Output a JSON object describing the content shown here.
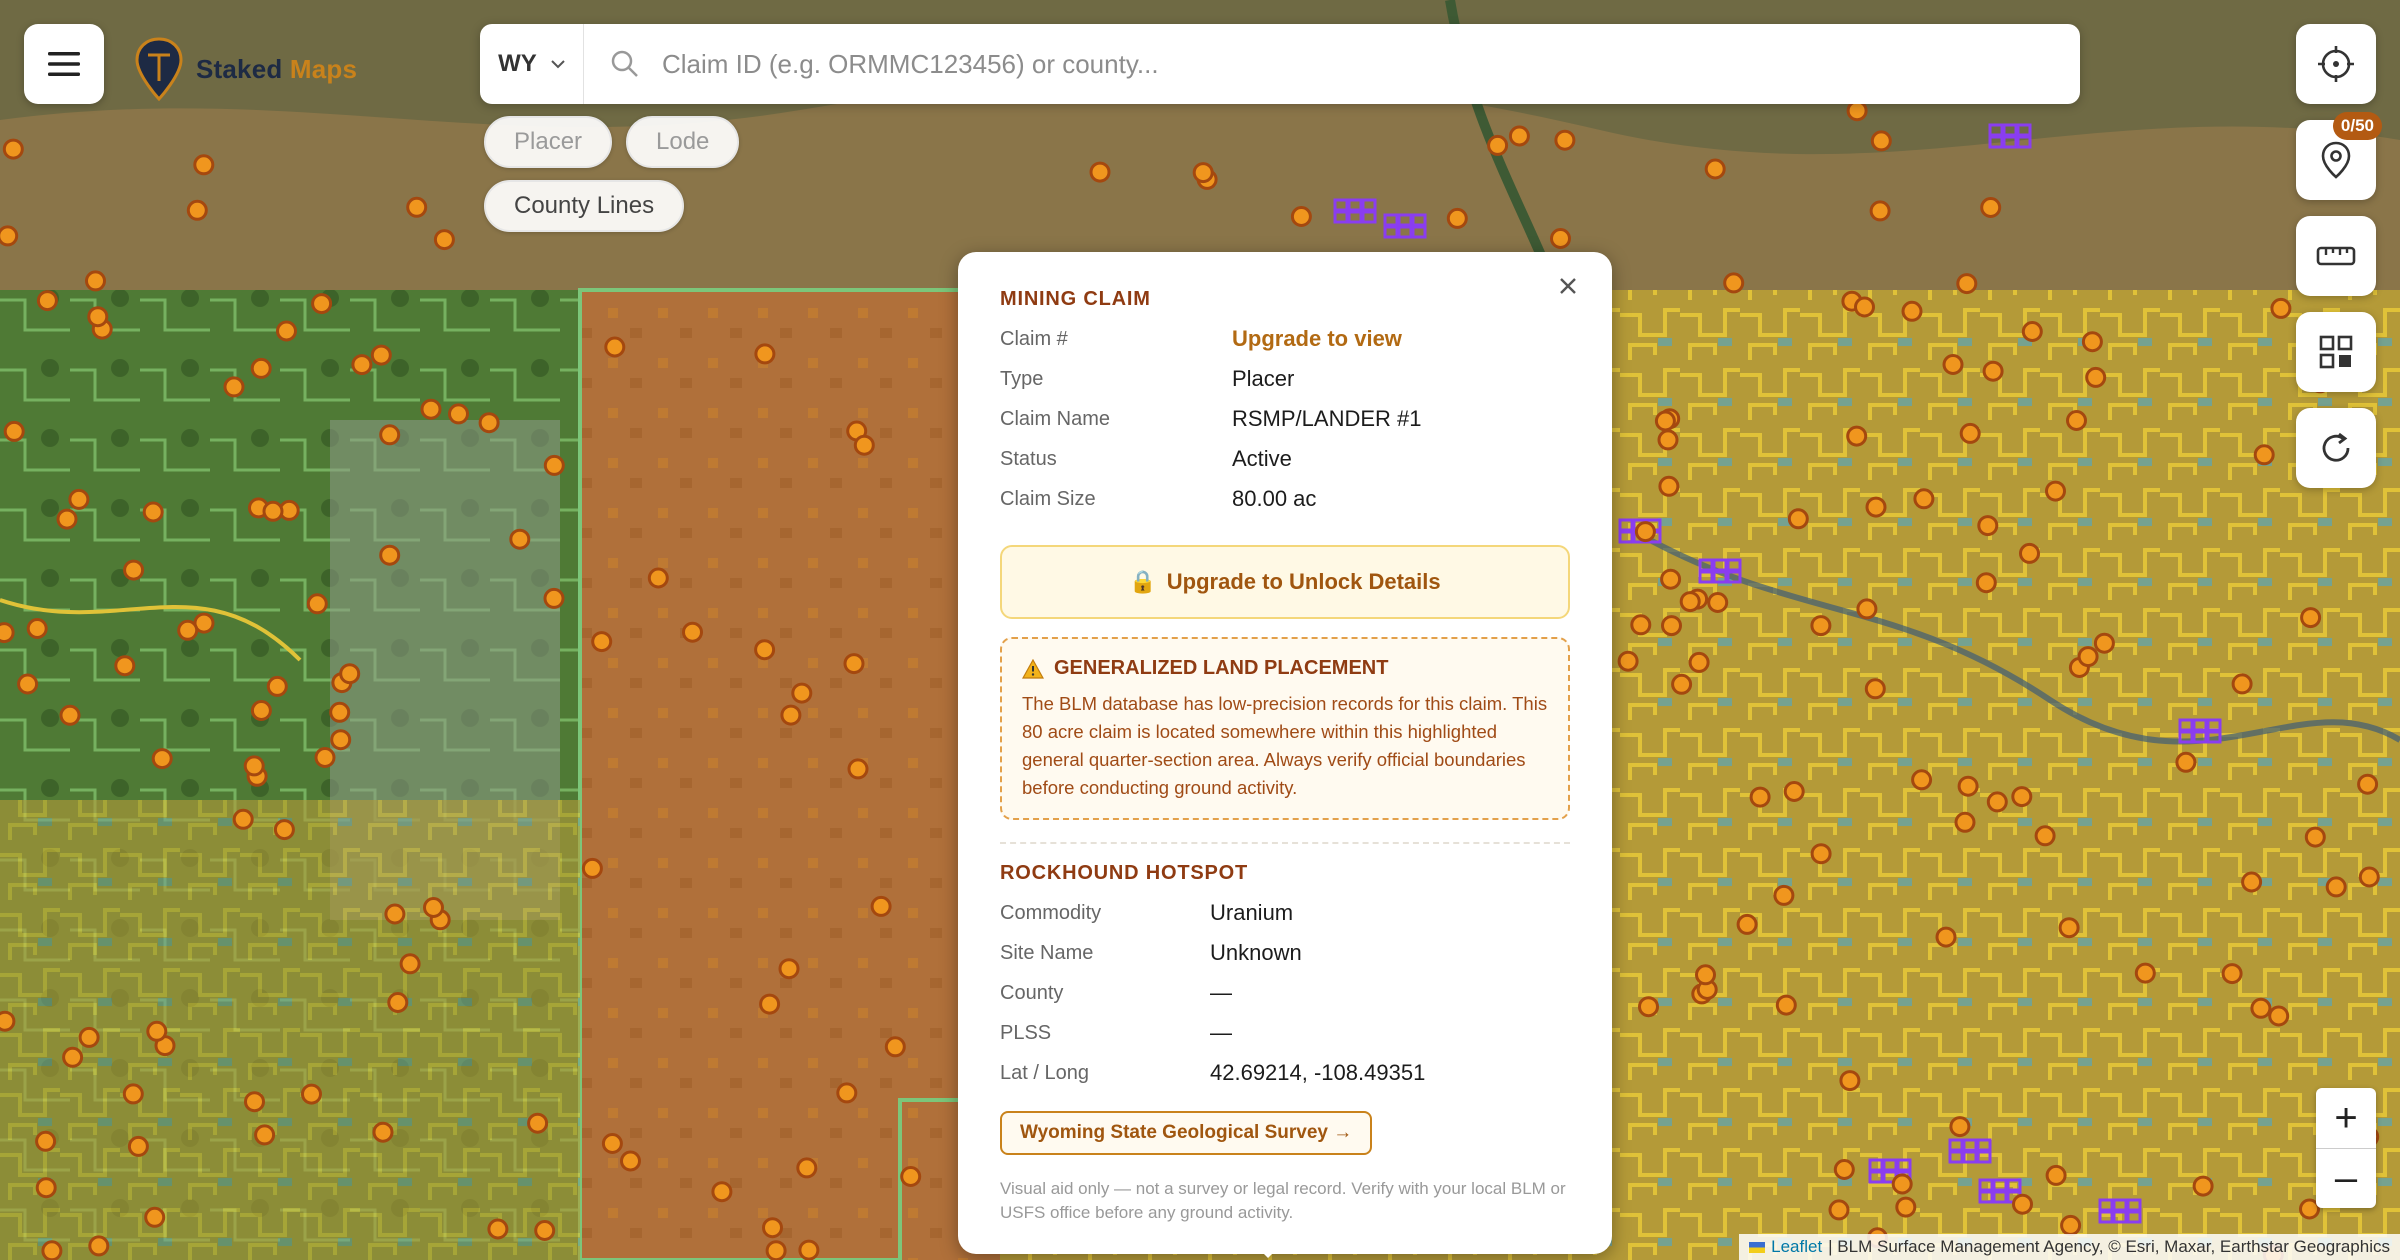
{
  "brand": {
    "name_part1": "Staked ",
    "name_part2": "Maps"
  },
  "search": {
    "state": "WY",
    "placeholder": "Claim ID (e.g. ORMMC123456) or county..."
  },
  "filters": [
    {
      "label": "Placer"
    },
    {
      "label": "Lode"
    },
    {
      "label": "County Lines"
    }
  ],
  "controls": {
    "pin_counter": "0/50"
  },
  "zoom": {
    "in": "+",
    "out": "–"
  },
  "attribution": {
    "leaflet": "Leaflet",
    "rest": "| BLM Surface Management Agency, © Esri, Maxar, Earthstar Geographics"
  },
  "popup": {
    "claim_title": "MINING CLAIM",
    "claim_rows": [
      {
        "label": "Claim #",
        "value": "Upgrade to view"
      },
      {
        "label": "Type",
        "value": "Placer"
      },
      {
        "label": "Claim Name",
        "value": "RSMP/LANDER #1"
      },
      {
        "label": "Status",
        "value": "Active"
      },
      {
        "label": "Claim Size",
        "value": "80.00 ac"
      }
    ],
    "upgrade_label": "Upgrade to Unlock Details",
    "warning_title": "GENERALIZED LAND PLACEMENT",
    "warning_text": "The BLM database has low-precision records for this claim. This 80 acre claim is located somewhere within this highlighted general quarter-section area. Always verify official boundaries before conducting ground activity.",
    "hotspot_title": "ROCKHOUND HOTSPOT",
    "hotspot_rows": [
      {
        "label": "Commodity",
        "value": "Uranium"
      },
      {
        "label": "Site Name",
        "value": "Unknown"
      },
      {
        "label": "County",
        "value": "—"
      },
      {
        "label": "PLSS",
        "value": "—"
      },
      {
        "label": "Lat / Long",
        "value": "42.69214, -108.49351"
      }
    ],
    "source_link": "Wyoming State Geological Survey →",
    "disclaimer": "Visual aid only — not a survey or legal record. Verify with your local BLM or USFS office before any ground activity."
  },
  "colors": {
    "marker_fill": "#f0961e",
    "marker_stroke": "#a4480f",
    "claim_purple": "#8a3df0",
    "blm_yellow": "#d9b93a",
    "usfs_green": "#5c9a52",
    "water_blue": "#4fb7d9"
  }
}
